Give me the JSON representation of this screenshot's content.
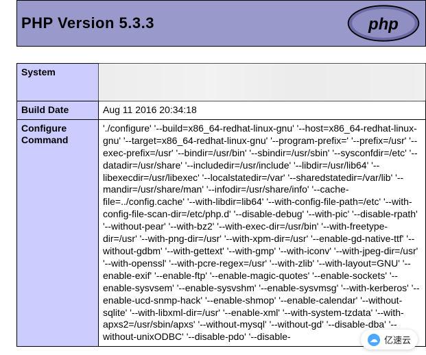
{
  "header": {
    "title": "PHP Version 5.3.3"
  },
  "rows": {
    "system": {
      "label": "System",
      "value": ""
    },
    "build_date": {
      "label": "Build Date",
      "value": "Aug 11 2016 20:34:18"
    },
    "configure": {
      "label": "Configure Command",
      "value": "'./configure' '--build=x86_64-redhat-linux-gnu' '--host=x86_64-redhat-linux-gnu' '--target=x86_64-redhat-linux-gnu' '--program-prefix=' '--prefix=/usr' '--exec-prefix=/usr' '--bindir=/usr/bin' '--sbindir=/usr/sbin' '--sysconfdir=/etc' '--datadir=/usr/share' '--includedir=/usr/include' '--libdir=/usr/lib64' '--libexecdir=/usr/libexec' '--localstatedir=/var' '--sharedstatedir=/var/lib' '--mandir=/usr/share/man' '--infodir=/usr/share/info' '--cache-file=../config.cache' '--with-libdir=lib64' '--with-config-file-path=/etc' '--with-config-file-scan-dir=/etc/php.d' '--disable-debug' '--with-pic' '--disable-rpath' '--without-pear' '--with-bz2' '--with-exec-dir=/usr/bin' '--with-freetype-dir=/usr' '--with-png-dir=/usr' '--with-xpm-dir=/usr' '--enable-gd-native-ttf' '--without-gdbm' '--with-gettext' '--with-gmp' '--with-iconv' '--with-jpeg-dir=/usr' '--with-openssl' '--with-pcre-regex=/usr' '--with-zlib' '--with-layout=GNU' '--enable-exif' '--enable-ftp' '--enable-magic-quotes' '--enable-sockets' '--enable-sysvsem' '--enable-sysvshm' '--enable-sysvmsg' '--with-kerberos' '--enable-ucd-snmp-hack' '--enable-shmop' '--enable-calendar' '--without-sqlite' '--with-libxml-dir=/usr' '--enable-xml' '--with-system-tzdata' '--with-apxs2=/usr/sbin/apxs' '--without-mysql' '--without-gd' '--disable-dba' '--without-unixODBC' '--disable-pdo' '--disable-"
    }
  },
  "badge": {
    "text": "亿速云"
  }
}
